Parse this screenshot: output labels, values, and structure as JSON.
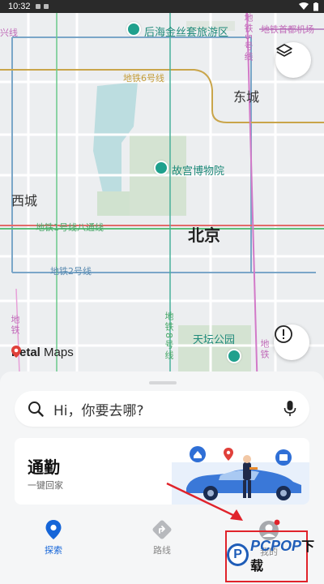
{
  "status_bar": {
    "time": "10:32"
  },
  "map": {
    "districts": {
      "dongcheng": "东城",
      "xicheng": "西城"
    },
    "city": "北京",
    "pois": {
      "houhai": "后海金丝套旅游区",
      "palace": "故宫博物院",
      "temple": "天坛公园"
    },
    "lines": {
      "line6": "地铁6号线",
      "line1": "地铁1号线八通线",
      "line2": "地铁2号线",
      "airport": "地铁首都机场",
      "line_partial_left": "兴线",
      "line8_vertical": "地铁8号线",
      "left_vertical": "地铁",
      "right_vertical": "地铁",
      "top_right_vertical": "地铁5号线"
    },
    "logo_text_bold": "Petal",
    "logo_text": " Maps"
  },
  "search": {
    "placeholder": "Hi，你要去哪?"
  },
  "commute": {
    "title": "通勤",
    "subtitle": "一键回家"
  },
  "nav": {
    "explore": "探索",
    "route": "路线",
    "me": "我的"
  },
  "watermark": {
    "brand": "PCPOP",
    "suffix": "下载"
  },
  "colors": {
    "accent": "#1565d8",
    "highlight": "#e0232b"
  }
}
